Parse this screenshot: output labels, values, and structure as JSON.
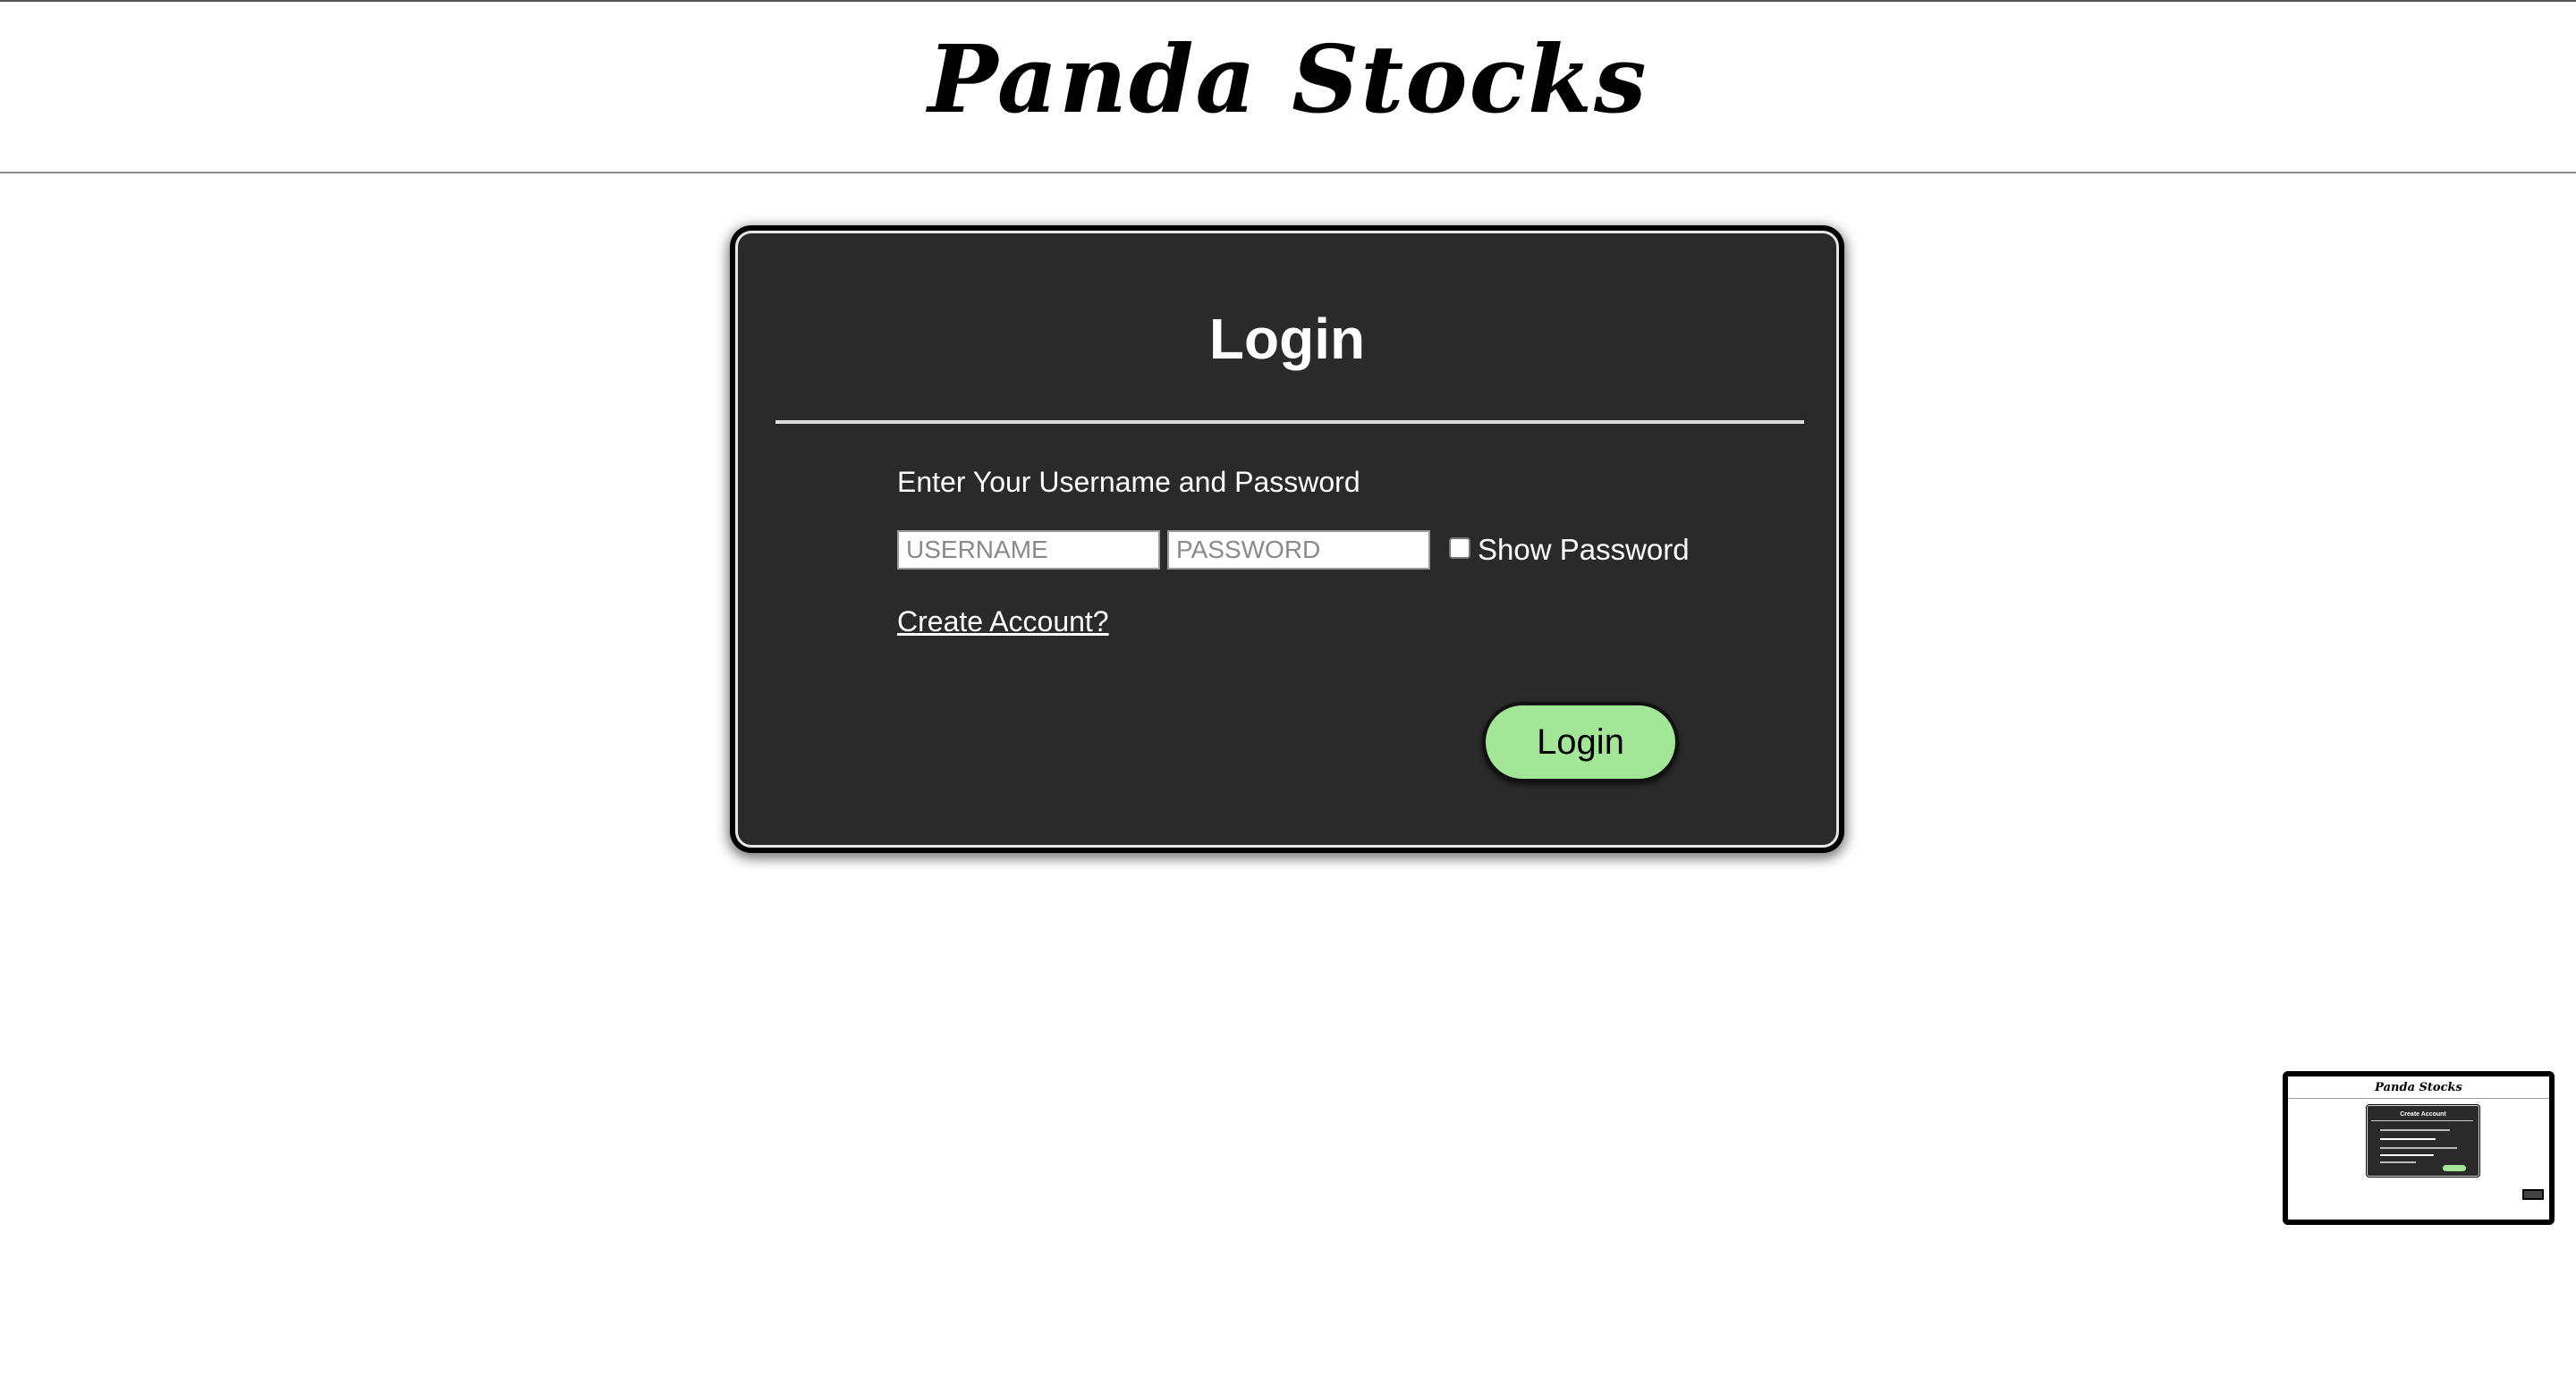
{
  "header": {
    "title": "Panda Stocks"
  },
  "login_card": {
    "title": "Login",
    "instructions": "Enter Your Username and Password",
    "username": {
      "value": "",
      "placeholder": "USERNAME"
    },
    "password": {
      "value": "",
      "placeholder": "PASSWORD"
    },
    "show_password": {
      "label": "Show Password",
      "checked": false
    },
    "create_account_link": "Create Account?",
    "login_button": "Login"
  },
  "thumbnail": {
    "title": "Panda Stocks",
    "card_title": "Create Account"
  },
  "colors": {
    "card_background": "#2a2a2a",
    "button_accent": "#a3e698",
    "page_background": "#ffffff"
  }
}
